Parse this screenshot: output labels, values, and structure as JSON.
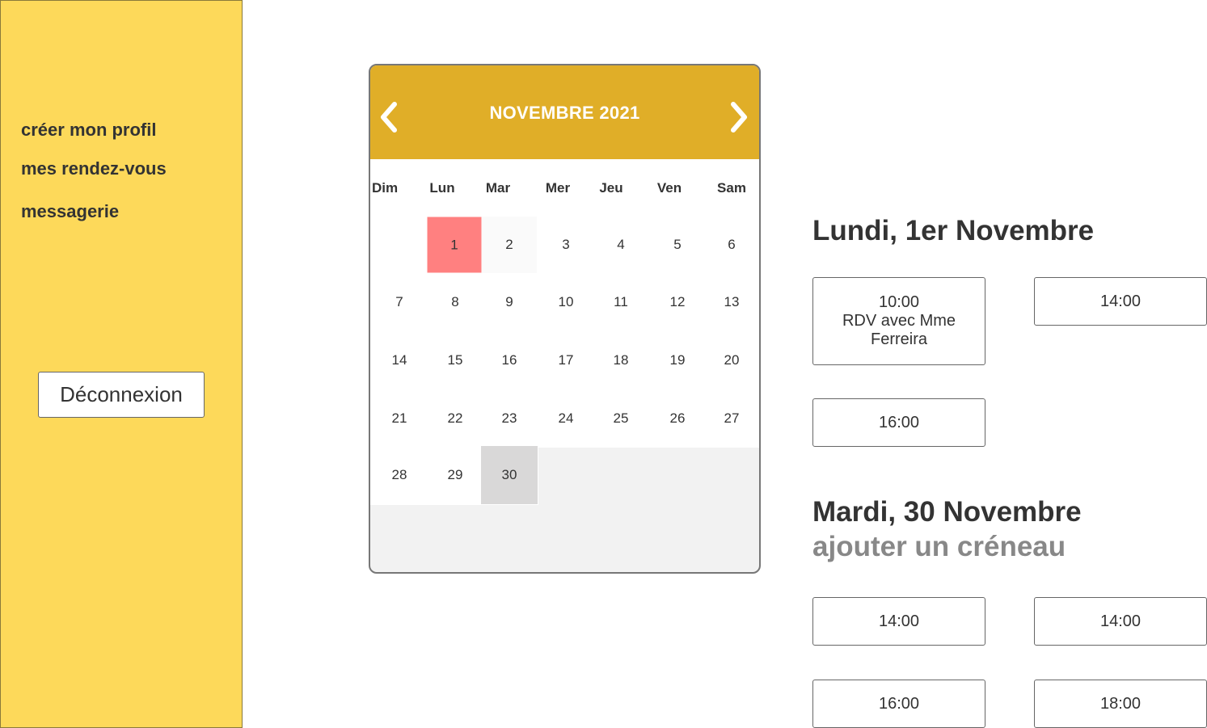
{
  "sidebar": {
    "nav": [
      "créer mon profil",
      "mes rendez-vous",
      "messagerie"
    ],
    "logout_label": "Déconnexion"
  },
  "calendar": {
    "month_label": "NOVEMBRE 2021",
    "weekdays": [
      "Dim",
      "Lun",
      "Mar",
      "Mer",
      "Jeu",
      "Ven",
      "Sam"
    ],
    "weeks": [
      [
        "",
        "1",
        "2",
        "3",
        "4",
        "5",
        "6"
      ],
      [
        "7",
        "8",
        "9",
        "10",
        "11",
        "12",
        "13"
      ],
      [
        "14",
        "15",
        "16",
        "17",
        "18",
        "19",
        "20"
      ],
      [
        "21",
        "22",
        "23",
        "24",
        "25",
        "26",
        "27"
      ],
      [
        "28",
        "29",
        "30"
      ]
    ],
    "today": "1",
    "selected": "30"
  },
  "day1": {
    "title": "Lundi, 1er Novembre",
    "slots": [
      {
        "time": "10:00",
        "line2": "RDV avec Mme",
        "line3": "Ferreira"
      },
      {
        "time": "14:00"
      },
      {
        "time": "16:00"
      }
    ]
  },
  "day2": {
    "title": "Mardi, 30 Novembre",
    "add_label": "ajouter un créneau",
    "slots": [
      {
        "time": "14:00"
      },
      {
        "time": "14:00"
      },
      {
        "time": "16:00"
      },
      {
        "time": "18:00"
      }
    ]
  },
  "colors": {
    "sidebar": "#fdd95a",
    "calendar_header": "#e0ae28",
    "today": "#ff8080",
    "selected": "#d9d8d8"
  },
  "icons": {
    "prev": "chevron-left-icon",
    "next": "chevron-right-icon"
  }
}
